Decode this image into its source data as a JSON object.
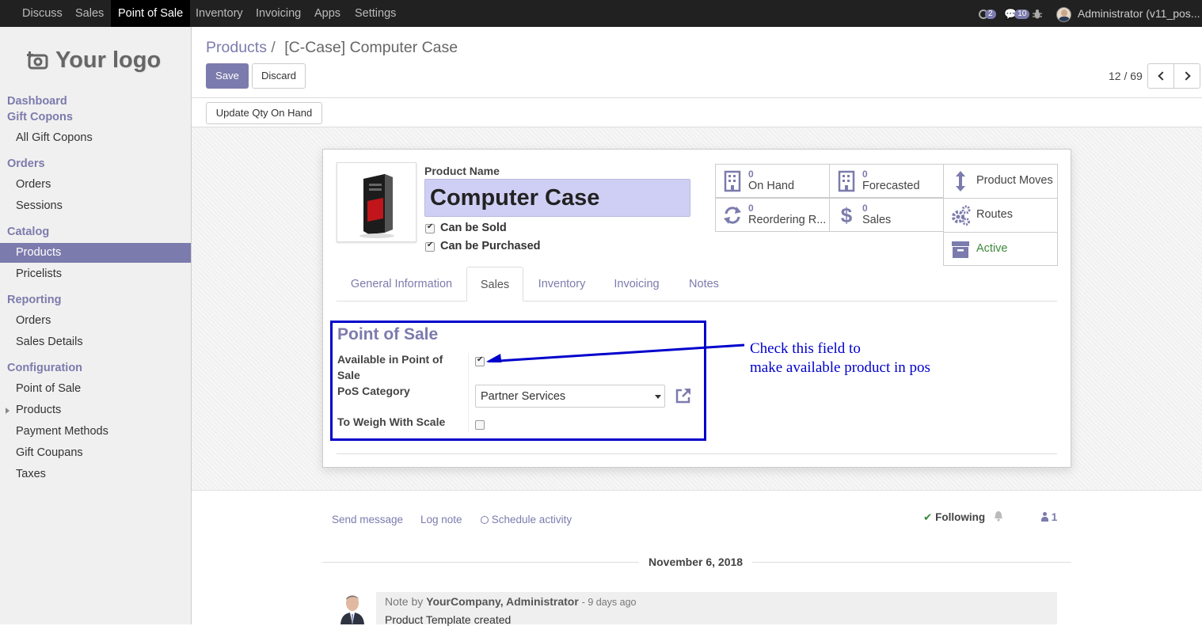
{
  "topbar": {
    "menus": [
      "Discuss",
      "Sales",
      "Point of Sale",
      "Inventory",
      "Invoicing",
      "Apps",
      "Settings"
    ],
    "activities_count": "2",
    "messages_count": "10",
    "user": "Administrator (v11_pos..."
  },
  "sidebar": {
    "logo_text": "Your logo",
    "sections": {
      "dashboard": "Dashboard",
      "gift_copons": "Gift Copons",
      "orders": "Orders",
      "catalog": "Catalog",
      "reporting": "Reporting",
      "configuration": "Configuration"
    },
    "items": {
      "all_gift_copons": "All Gift Copons",
      "orders": "Orders",
      "sessions": "Sessions",
      "products": "Products",
      "pricelists": "Pricelists",
      "report_orders": "Orders",
      "sales_details": "Sales Details",
      "cfg_pos": "Point of Sale",
      "cfg_products": "Products",
      "payment_methods": "Payment Methods",
      "gift_coupans": "Gift Coupans",
      "taxes": "Taxes"
    }
  },
  "breadcrumb": {
    "parent": "Products",
    "sep": "/",
    "current": "[C-Case] Computer Case"
  },
  "buttons": {
    "save": "Save",
    "discard": "Discard",
    "update_qty": "Update Qty On Hand"
  },
  "pager": {
    "value": "12 / 69"
  },
  "product": {
    "name_label": "Product Name",
    "name": "Computer Case",
    "can_be_sold": "Can be Sold",
    "can_be_purchased": "Can be Purchased"
  },
  "smart_buttons": {
    "on_hand": {
      "value": "0",
      "label": "On Hand"
    },
    "forecasted": {
      "value": "0",
      "label": "Forecasted"
    },
    "product_moves": "Product Moves",
    "reordering": {
      "value": "0",
      "label": "Reordering R..."
    },
    "sales": {
      "value": "0",
      "label": "Sales"
    },
    "routes": "Routes",
    "active": "Active"
  },
  "tabs": [
    "General Information",
    "Sales",
    "Inventory",
    "Invoicing",
    "Notes"
  ],
  "pos_section": {
    "title": "Point of Sale",
    "available_label_1": "Available in Point of",
    "available_label_2": "Sale",
    "category_label": "PoS Category",
    "category_value": "Partner Services",
    "weigh_label": "To Weigh With Scale"
  },
  "annotation": {
    "line1": "Check this field to",
    "line2": "make available product in pos"
  },
  "chatter": {
    "send_message": "Send message",
    "log_note": "Log note",
    "schedule_activity": "Schedule activity",
    "following": "Following",
    "followers": "1",
    "date": "November 6, 2018",
    "note_prefix": "Note by",
    "author": "YourCompany, Administrator",
    "time": "- 9 days ago",
    "body": "Product Template created"
  },
  "colors": {
    "brand": "#7c7bad",
    "highlight_box": "#0000cc",
    "annotation": "#0000cc",
    "active_green": "#3c8a3c"
  }
}
